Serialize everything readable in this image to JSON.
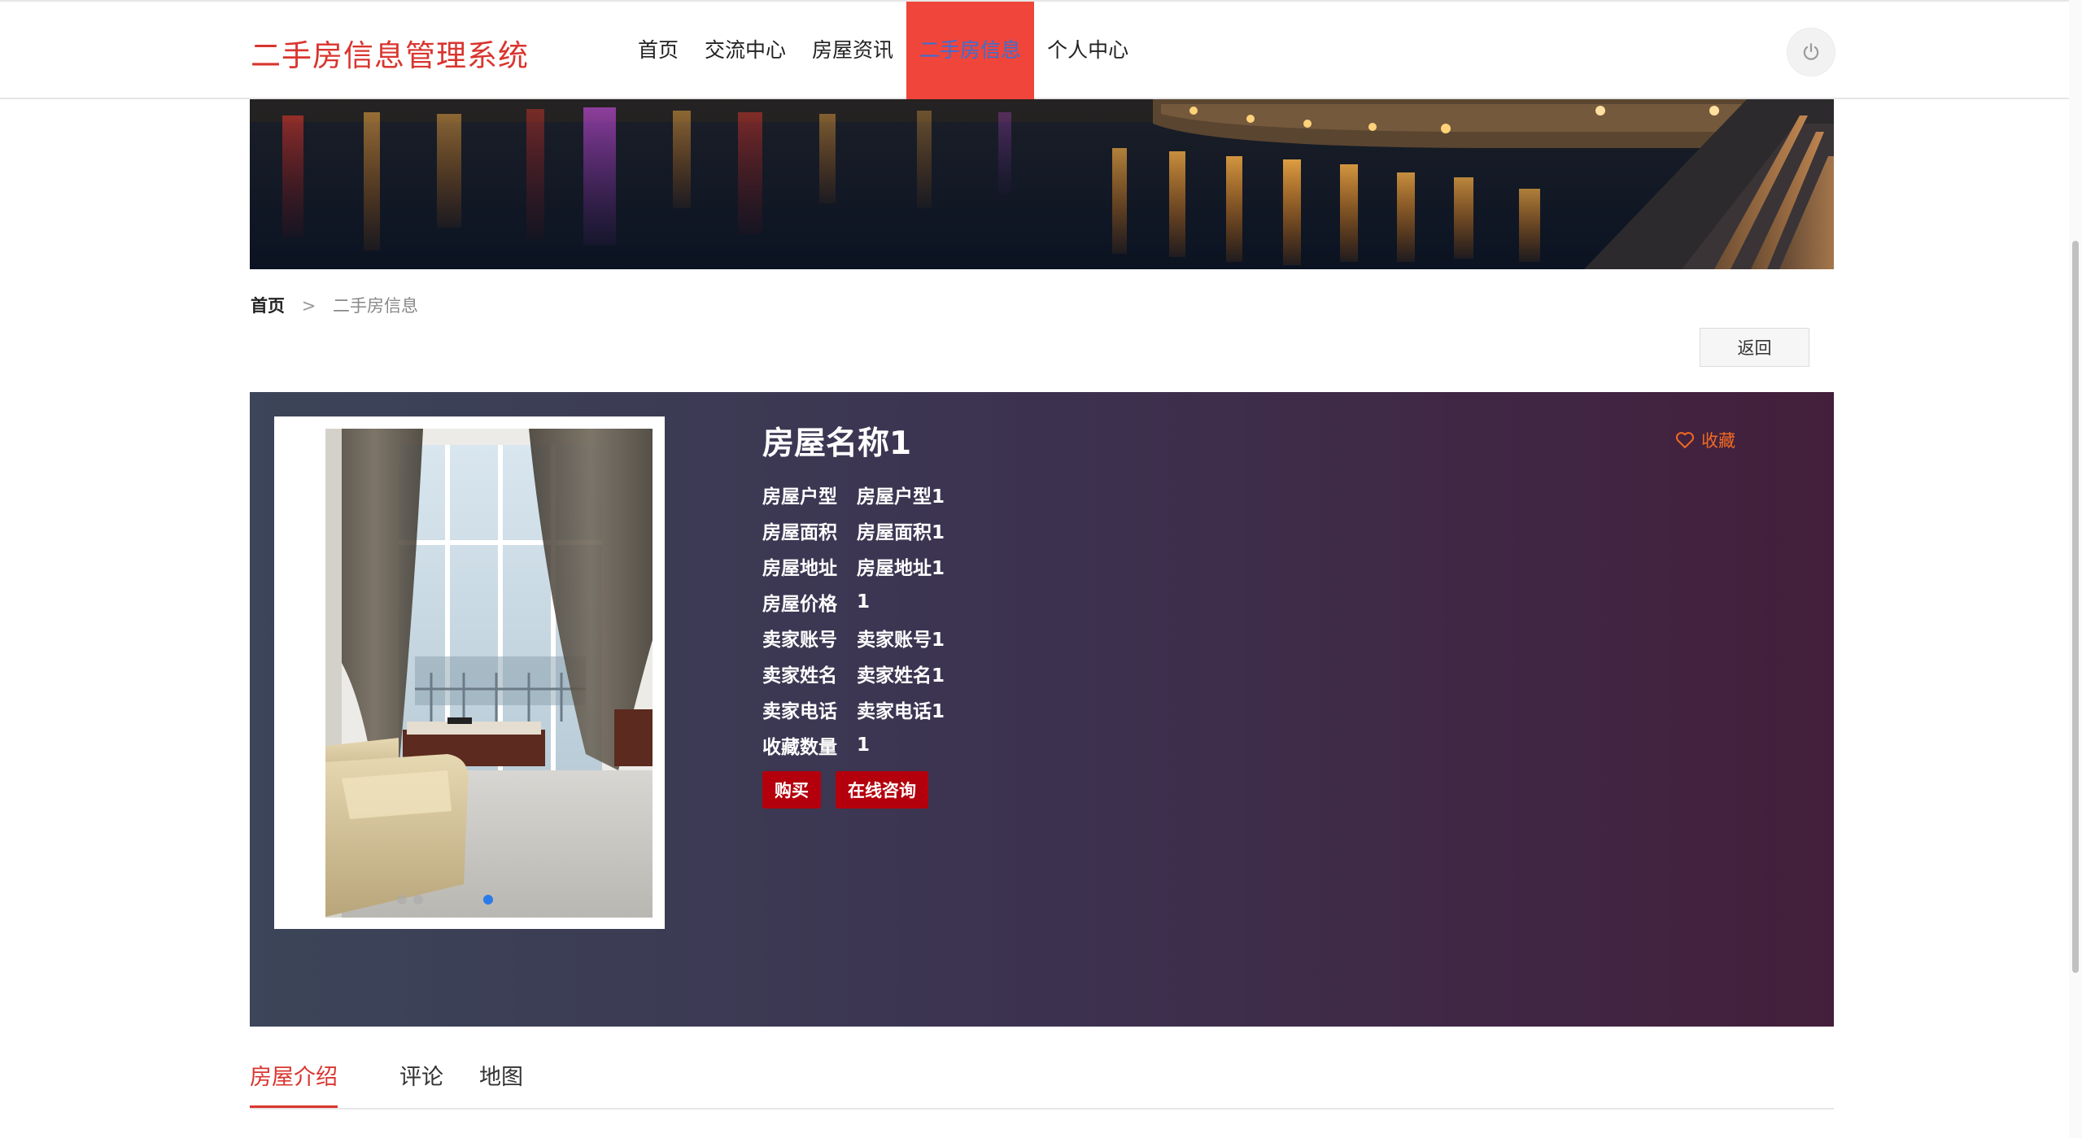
{
  "header": {
    "brand": "二手房信息管理系统",
    "nav": [
      "首页",
      "交流中心",
      "房屋资讯",
      "二手房信息",
      "个人中心"
    ],
    "active_index": 3,
    "power_icon": "power-icon"
  },
  "breadcrumb": {
    "home": "首页",
    "separator": ">",
    "current": "二手房信息"
  },
  "back_label": "返回",
  "house": {
    "title": "房屋名称1",
    "favorite_label": "收藏",
    "favorite_icon": "heart-icon",
    "attributes": [
      {
        "key": "房屋户型",
        "value": "房屋户型1"
      },
      {
        "key": "房屋面积",
        "value": "房屋面积1"
      },
      {
        "key": "房屋地址",
        "value": "房屋地址1"
      },
      {
        "key": "房屋价格",
        "value": "1"
      },
      {
        "key": "卖家账号",
        "value": "卖家账号1"
      },
      {
        "key": "卖家姓名",
        "value": "卖家姓名1"
      },
      {
        "key": "卖家电话",
        "value": "卖家电话1"
      },
      {
        "key": "收藏数量",
        "value": "1"
      }
    ],
    "buy_label": "购买",
    "consult_label": "在线咨询",
    "carousel_active": 2
  },
  "tabs": [
    "房屋介绍",
    "评论",
    "地图"
  ],
  "active_tab": 0,
  "colors": {
    "brand": "#d9352f",
    "nav_active_bg": "#f0453a",
    "nav_active_text": "#3b6fd4",
    "button": "#b4000c",
    "favorite": "#f26a22"
  }
}
